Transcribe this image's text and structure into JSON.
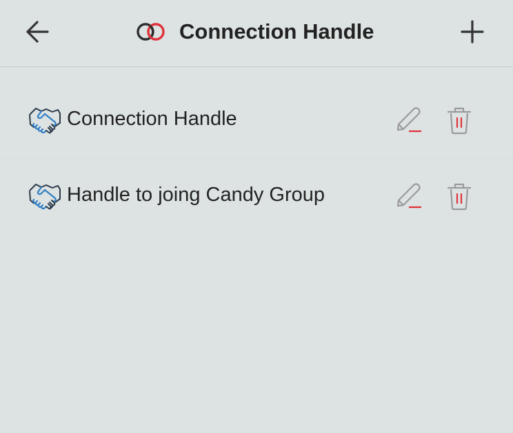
{
  "header": {
    "title": "Connection Handle",
    "back_icon": "arrow-left-icon",
    "title_icon": "linked-rings-icon",
    "add_icon": "plus-icon"
  },
  "list": {
    "items": [
      {
        "label": "Connection Handle",
        "icon": "handshake-icon"
      },
      {
        "label": "Handle to joing Candy Group",
        "icon": "handshake-icon"
      }
    ]
  },
  "colors": {
    "background": "#dde2e2",
    "accent_red": "#e0313a",
    "icon_blue": "#2f7ec4",
    "action_gray": "#9a9a9a",
    "text": "#222222"
  }
}
